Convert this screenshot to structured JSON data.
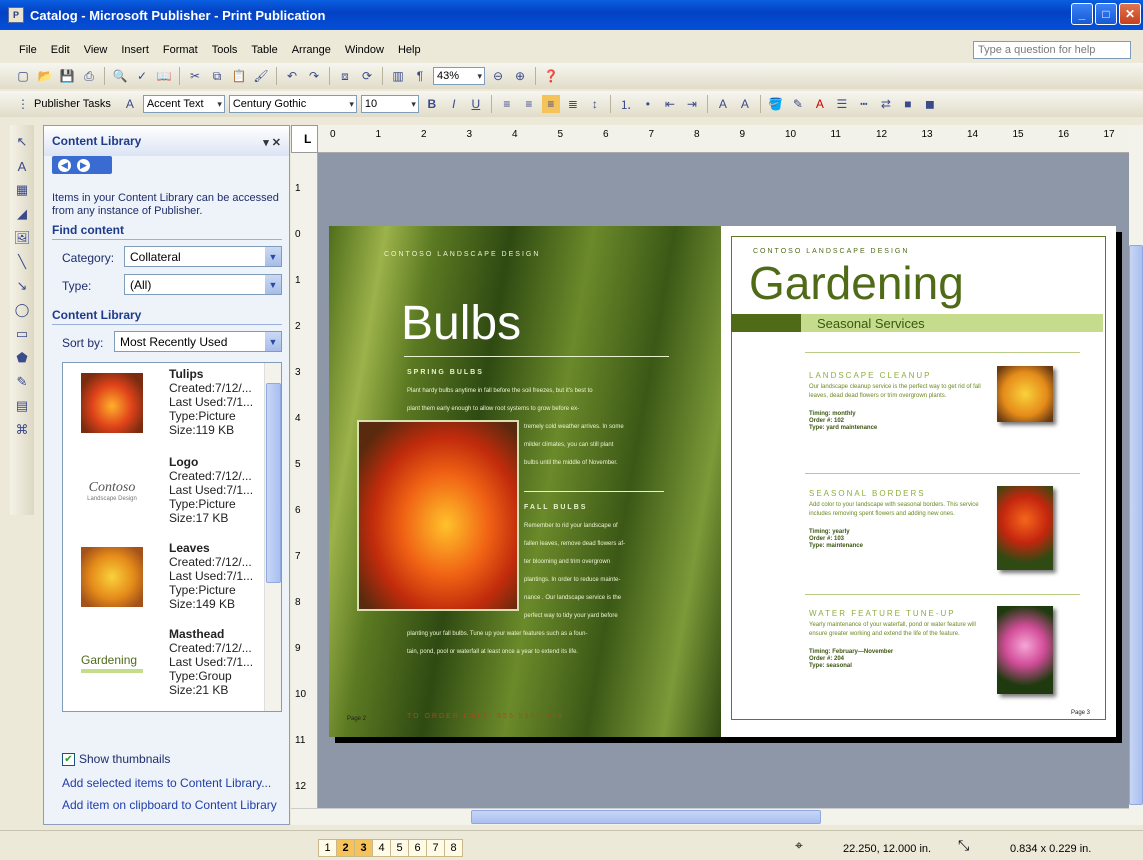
{
  "window": {
    "title": "Catalog - Microsoft Publisher - Print Publication"
  },
  "menu": {
    "items": [
      "File",
      "Edit",
      "View",
      "Insert",
      "Format",
      "Tools",
      "Table",
      "Arrange",
      "Window",
      "Help"
    ],
    "help_placeholder": "Type a question for help"
  },
  "toolbar": {
    "zoom": "43%",
    "tasks_label": "Publisher Tasks",
    "style": "Accent Text",
    "font": "Century Gothic",
    "size": "10"
  },
  "taskpane": {
    "title": "Content Library",
    "description": "Items in your Content Library can be accessed from any instance of Publisher.",
    "find_heading": "Find content",
    "category_label": "Category:",
    "category_value": "Collateral",
    "type_label": "Type:",
    "type_value": "(All)",
    "library_heading": "Content Library",
    "sort_label": "Sort by:",
    "sort_value": "Most Recently Used",
    "items": [
      {
        "name": "Tulips",
        "created": "Created:7/12/...",
        "last_used": "Last Used:7/1...",
        "type": "Type:Picture",
        "size": "Size:119 KB"
      },
      {
        "name": "Logo",
        "created": "Created:7/12/...",
        "last_used": "Last Used:7/1...",
        "type": "Type:Picture",
        "size": "Size:17 KB"
      },
      {
        "name": "Leaves",
        "created": "Created:7/12/...",
        "last_used": "Last Used:7/1...",
        "type": "Type:Picture",
        "size": "Size:149 KB"
      },
      {
        "name": "Masthead",
        "created": "Created:7/12/...",
        "last_used": "Last Used:7/1...",
        "type": "Type:Group",
        "size": "Size:21 KB"
      }
    ],
    "logo_thumb": "Contoso",
    "logo_sub": "Landscape Design",
    "masthead_thumb": "Gardening",
    "show_thumbnails": "Show thumbnails",
    "link_add_selected": "Add selected items to Content Library...",
    "link_add_clipboard": "Add item on clipboard to Content Library"
  },
  "left_page": {
    "company": "CONTOSO LANDSCAPE DESIGN",
    "title": "Bulbs",
    "spring_heading": "SPRING BULBS",
    "spring_text_1": "Plant hardy bulbs anytime in fall before the soil freezes, but it's best to",
    "spring_text_2": "plant them early enough to allow root systems to grow before ex-",
    "spring_text_3": "tremely cold weather arrives. In some",
    "spring_text_4": "milder climates, you can still plant",
    "spring_text_5": "bulbs until the middle of November.",
    "fall_heading": "FALL BULBS",
    "fall_text_1": "Remember to rid your landscape of",
    "fall_text_2": "fallen leaves, remove dead flowers af-",
    "fall_text_3": "ter blooming and trim overgrown",
    "fall_text_4": "plantings. In order to reduce mainte-",
    "fall_text_5": "nance . Our landscape service is the",
    "fall_text_6": "perfect way to tidy your yard before",
    "fall_text_7": "planting your fall bulbs. Tune up your water features such as a foun-",
    "fall_text_8": "tain, pond, pool or waterfall at least once a year to extend its life.",
    "page_label": "Page 2",
    "footer": "TO ORDER CALL: 555 555 0199"
  },
  "right_page": {
    "company": "CONTOSO LANDSCAPE DESIGN",
    "title": "Gardening",
    "subtitle": "Seasonal Services",
    "s1_h": "LANDSCAPE CLEANUP",
    "s1_b": "Our landscape cleanup service is the perfect way to get rid of fall leaves, dead dead flowers or trim overgrown plants.",
    "s1_m1": "Timing: monthly",
    "s1_m2": "Order #: 102",
    "s1_m3": "Type: yard maintenance",
    "s2_h": "SEASONAL BORDERS",
    "s2_b": "Add color to your landscape with seasonal borders. This service includes removing spent flowers and adding new ones.",
    "s2_m1": "Timing: yearly",
    "s2_m2": "Order #: 103",
    "s2_m3": "Type: maintenance",
    "s3_h": "WATER FEATURE TUNE-UP",
    "s3_b": "Yearly maintenance of your waterfall, pond or water feature will ensure greater working and extend the life of the feature.",
    "s3_m1": "Timing: February—November",
    "s3_m2": "Order #: 204",
    "s3_m3": "Type: seasonal",
    "page_label": "Page 3"
  },
  "ruler_h": [
    "0",
    "1",
    "2",
    "3",
    "4",
    "5",
    "6",
    "7",
    "8",
    "9",
    "10",
    "11",
    "12",
    "13",
    "14",
    "15",
    "16",
    "17"
  ],
  "ruler_v": [
    "1",
    "0",
    "1",
    "2",
    "3",
    "4",
    "5",
    "6",
    "7",
    "8",
    "9",
    "10",
    "11",
    "12"
  ],
  "status": {
    "pages": [
      "1",
      "2",
      "3",
      "4",
      "5",
      "6",
      "7",
      "8"
    ],
    "position": "22.250, 12.000 in.",
    "size": "0.834 x 0.229 in."
  }
}
